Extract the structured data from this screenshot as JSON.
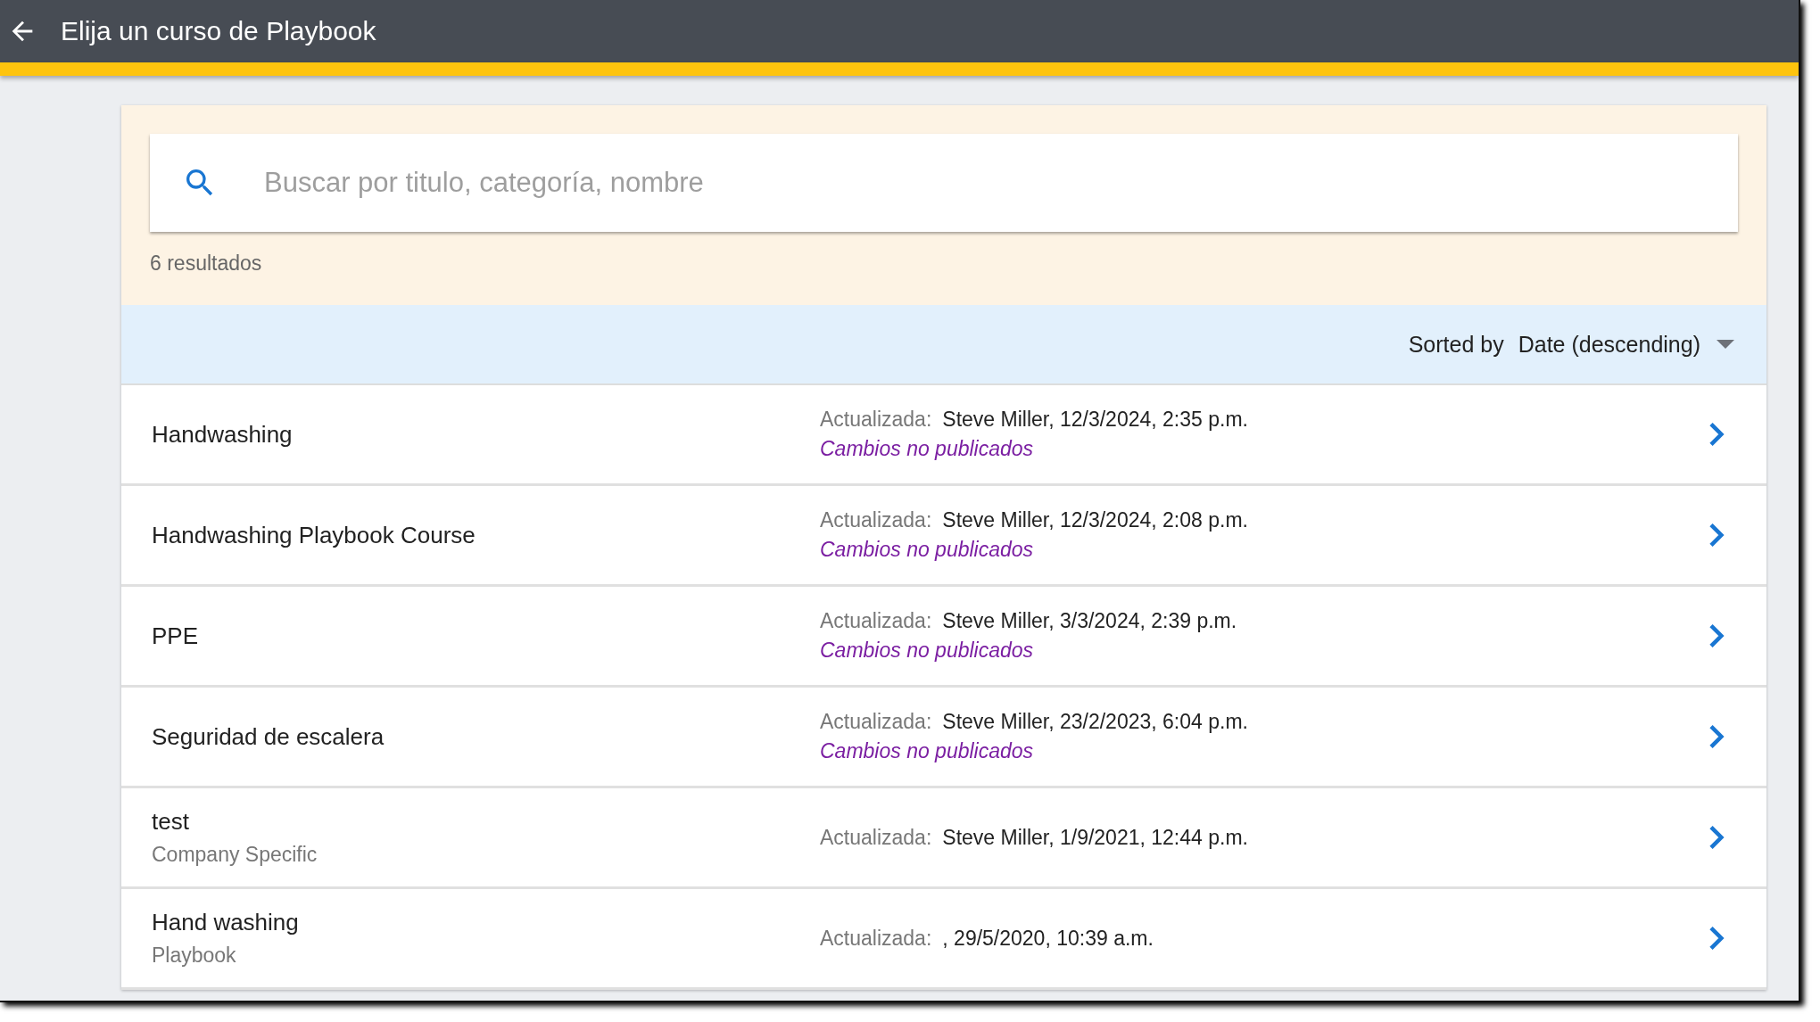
{
  "header": {
    "title": "Elija un curso de Playbook"
  },
  "search": {
    "placeholder": "Buscar por titulo, categoría, nombre"
  },
  "result_count": "6 resultados",
  "sort": {
    "label": "Sorted by",
    "value": "Date (descending)"
  },
  "courses": [
    {
      "title": "Handwashing",
      "updated_label": "Actualizada:",
      "updated": "Steve Miller, 12/3/2024, 2:35 p.m.",
      "status": "Cambios no publicados"
    },
    {
      "title": "Handwashing Playbook Course",
      "updated_label": "Actualizada:",
      "updated": "Steve Miller, 12/3/2024, 2:08 p.m.",
      "status": "Cambios no publicados"
    },
    {
      "title": "PPE",
      "updated_label": "Actualizada:",
      "updated": "Steve Miller, 3/3/2024, 2:39 p.m.",
      "status": "Cambios no publicados"
    },
    {
      "title": "Seguridad de escalera",
      "updated_label": "Actualizada:",
      "updated": "Steve Miller, 23/2/2023, 6:04 p.m.",
      "status": "Cambios no publicados"
    },
    {
      "title": "test",
      "category": "Company Specific",
      "updated_label": "Actualizada:",
      "updated": "Steve Miller, 1/9/2021, 12:44 p.m."
    },
    {
      "title": "Hand washing",
      "category": "Playbook",
      "updated_label": "Actualizada:",
      "updated": ", 29/5/2020, 10:39 a.m."
    }
  ]
}
